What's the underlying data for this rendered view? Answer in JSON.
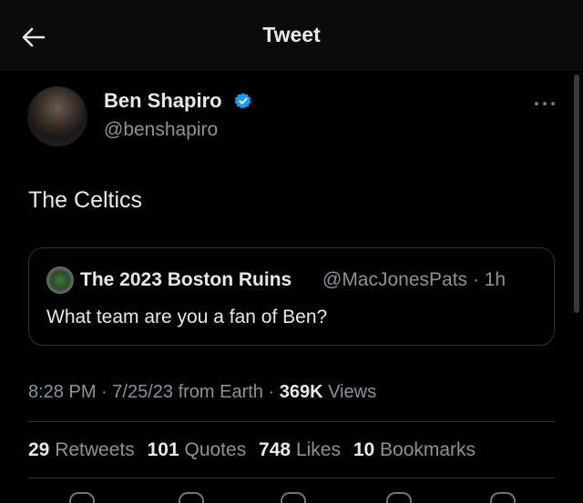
{
  "header": {
    "title": "Tweet"
  },
  "author": {
    "name": "Ben Shapiro",
    "handle": "@benshapiro"
  },
  "tweet": {
    "text": "The Celtics"
  },
  "quote": {
    "author_name": "The 2023 Boston Ruins",
    "handle": "@MacJonesPats",
    "separator": "·",
    "time": "1h",
    "text": "What team are you a fan of Ben?"
  },
  "meta": {
    "time": "8:28 PM",
    "date": "7/25/23",
    "source": "from Earth",
    "views_count": "369K",
    "views_label": "Views"
  },
  "stats": [
    {
      "num": "29",
      "label": "Retweets"
    },
    {
      "num": "101",
      "label": "Quotes"
    },
    {
      "num": "748",
      "label": "Likes"
    },
    {
      "num": "10",
      "label": "Bookmarks"
    }
  ],
  "colors": {
    "background": "#000000",
    "text": "#e7e9ea",
    "muted": "#8b9299",
    "verified": "#1d9bf0",
    "border": "#2f3336"
  },
  "icons": [
    "back-arrow-icon",
    "verified-badge-icon",
    "more-options-icon"
  ]
}
